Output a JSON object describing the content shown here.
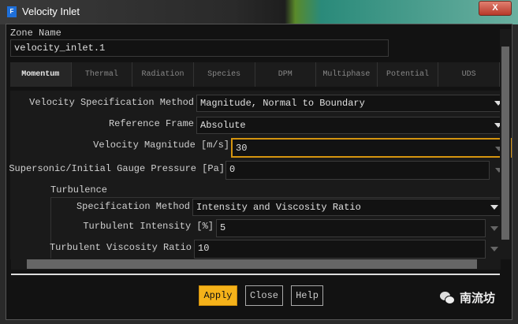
{
  "window": {
    "title": "Velocity Inlet",
    "app_icon": "F",
    "close_glyph": "X"
  },
  "zone": {
    "label": "Zone Name",
    "value": "velocity_inlet.1"
  },
  "tabs": [
    "Momentum",
    "Thermal",
    "Radiation",
    "Species",
    "DPM",
    "Multiphase",
    "Potential",
    "UDS"
  ],
  "active_tab": "Momentum",
  "form": {
    "velocity_spec_method": {
      "label": "Velocity Specification Method",
      "value": "Magnitude, Normal to Boundary"
    },
    "reference_frame": {
      "label": "Reference Frame",
      "value": "Absolute"
    },
    "velocity_magnitude": {
      "label": "Velocity Magnitude [m/s]",
      "value": "30"
    },
    "gauge_pressure": {
      "label": "Supersonic/Initial Gauge Pressure [Pa]",
      "value": "0"
    }
  },
  "turbulence": {
    "label": "Turbulence",
    "spec_method": {
      "label": "Specification Method",
      "value": "Intensity and Viscosity Ratio"
    },
    "intensity": {
      "label": "Turbulent Intensity [%]",
      "value": "5"
    },
    "viscosity_ratio": {
      "label": "Turbulent Viscosity Ratio",
      "value": "10"
    }
  },
  "buttons": {
    "apply": "Apply",
    "close": "Close",
    "help": "Help"
  },
  "watermark": "南流坊",
  "colors": {
    "accent": "#f5b21a",
    "focus_border": "#d4940f"
  }
}
